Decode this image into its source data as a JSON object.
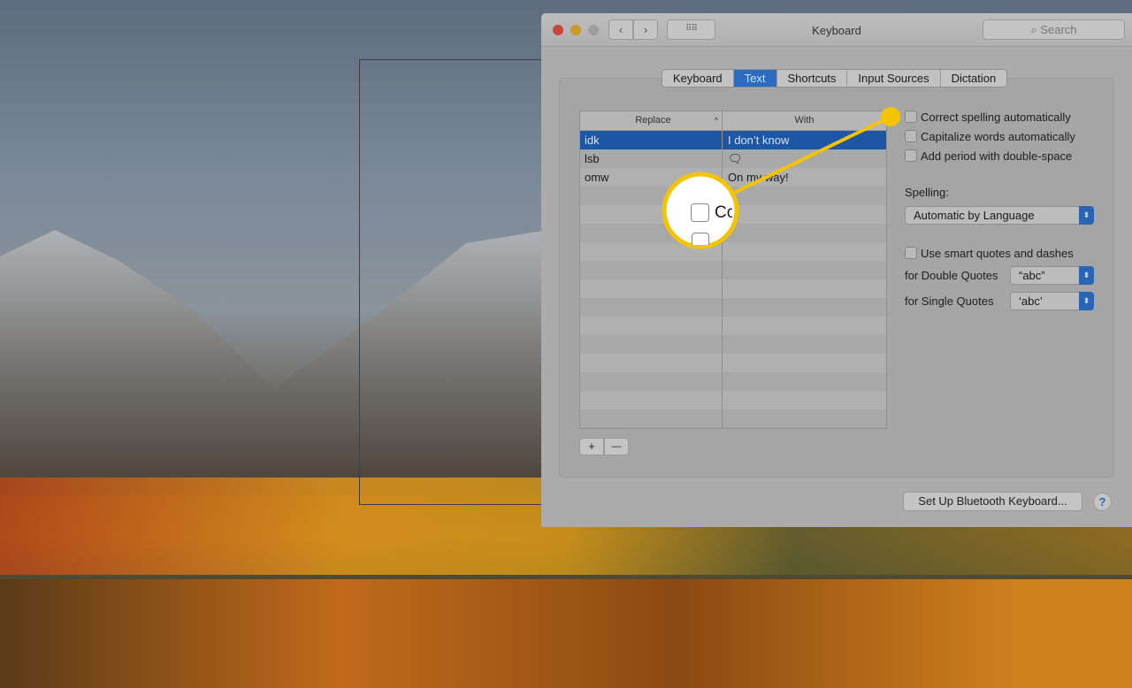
{
  "window": {
    "title": "Keyboard",
    "search_placeholder": "Search",
    "grid_icon": "grid-icon"
  },
  "tabs": [
    {
      "label": "Keyboard"
    },
    {
      "label": "Text",
      "selected": true
    },
    {
      "label": "Shortcuts"
    },
    {
      "label": "Input Sources"
    },
    {
      "label": "Dictation"
    }
  ],
  "table": {
    "headers": {
      "replace": "Replace",
      "with": "With"
    },
    "rows": [
      {
        "replace": "idk",
        "with": "I don’t know",
        "selected": true
      },
      {
        "replace": "lsb",
        "with": "🗨"
      },
      {
        "replace": "omw",
        "with": "On my way!"
      }
    ]
  },
  "buttons": {
    "add": "+",
    "remove": "—",
    "bluetooth": "Set Up Bluetooth Keyboard...",
    "help": "?"
  },
  "options": {
    "correct_spelling": "Correct spelling automatically",
    "capitalize": "Capitalize words automatically",
    "period": "Add period with double-space",
    "spelling_label": "Spelling:",
    "spelling_value": "Automatic by Language",
    "smart_quotes": "Use smart quotes and dashes",
    "double_label": "for Double Quotes",
    "double_value": "“abc”",
    "single_label": "for Single Quotes",
    "single_value": "‘abc’"
  },
  "callout": {
    "text": "Co",
    "color": "#f5c400"
  }
}
